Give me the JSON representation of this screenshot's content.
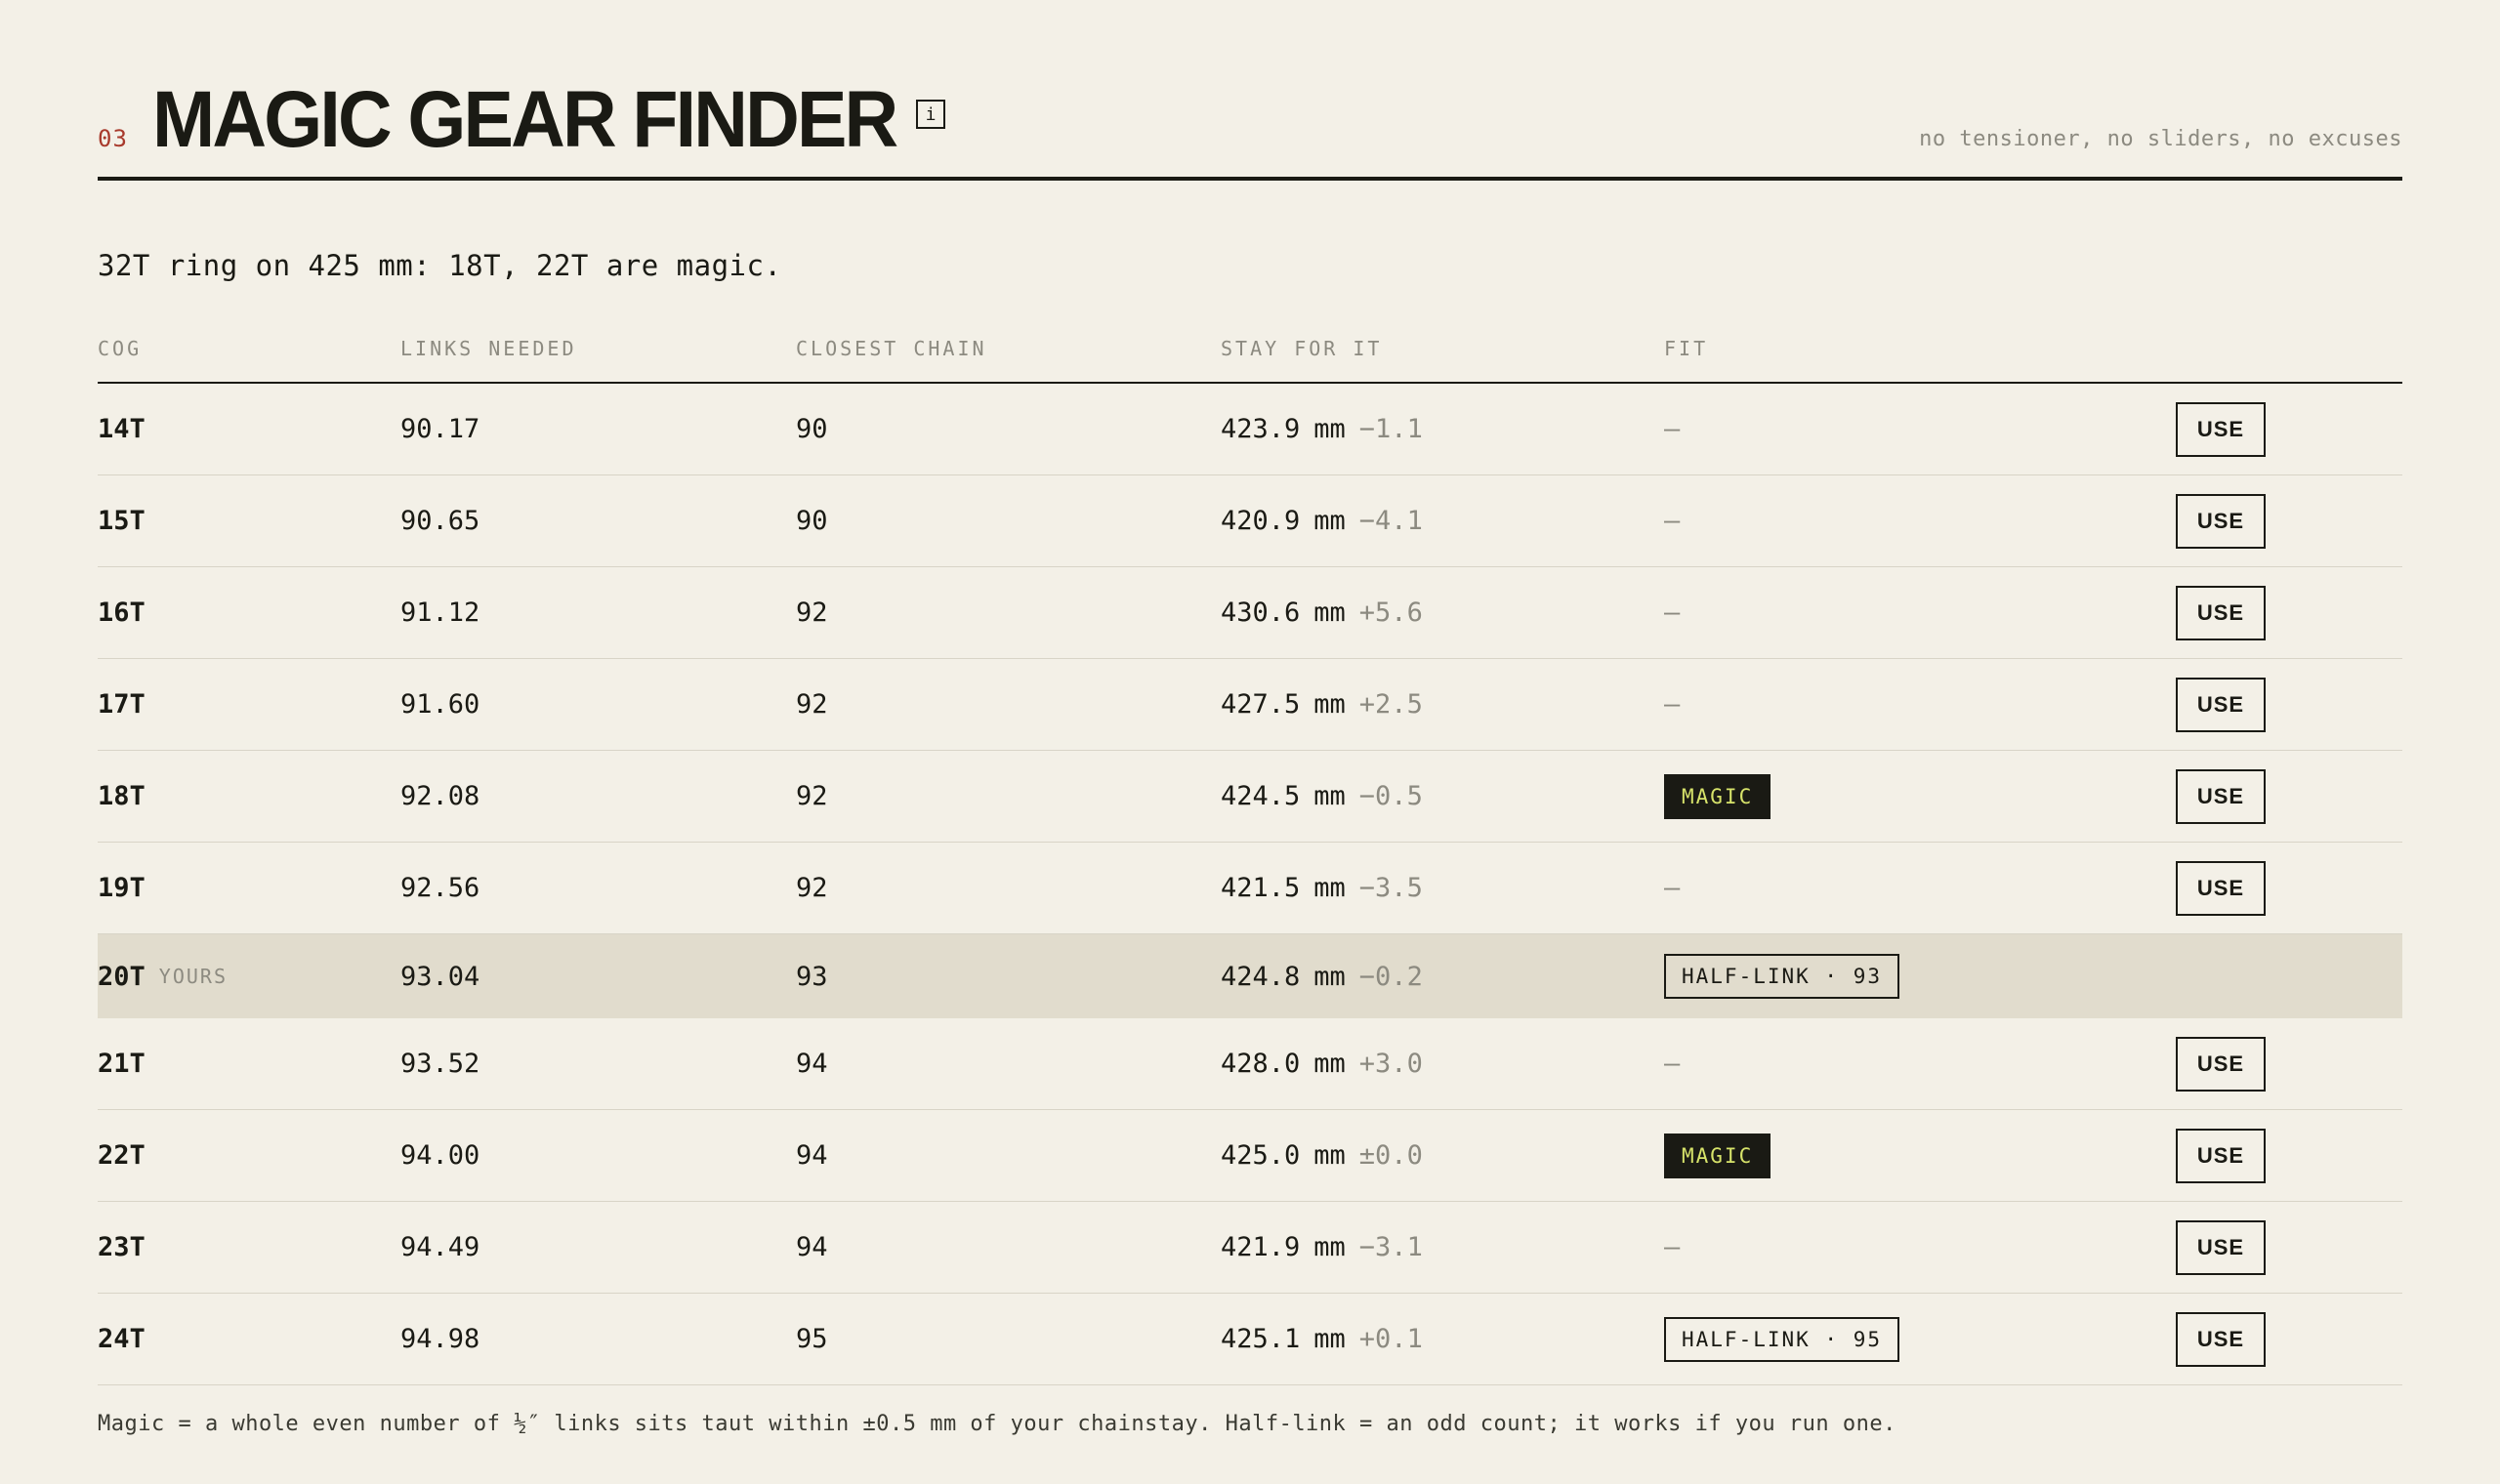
{
  "header": {
    "section_number": "03",
    "title": "MAGIC GEAR FINDER",
    "info_icon_glyph": "i",
    "tagline": "no tensioner, no sliders, no excuses"
  },
  "summary": "32T ring on 425 mm: 18T, 22T are magic.",
  "columns": {
    "cog": "COG",
    "links": "LINKS NEEDED",
    "chain": "CLOSEST CHAIN",
    "stay": "STAY FOR IT",
    "fit": "FIT"
  },
  "rows": [
    {
      "cog": "14T",
      "yours": "",
      "links": "90.17",
      "chain": "90",
      "stay": "423.9",
      "unit": "mm",
      "delta": "−1.1",
      "fit": "—",
      "fit_type": "none",
      "action": "USE"
    },
    {
      "cog": "15T",
      "yours": "",
      "links": "90.65",
      "chain": "90",
      "stay": "420.9",
      "unit": "mm",
      "delta": "−4.1",
      "fit": "—",
      "fit_type": "none",
      "action": "USE"
    },
    {
      "cog": "16T",
      "yours": "",
      "links": "91.12",
      "chain": "92",
      "stay": "430.6",
      "unit": "mm",
      "delta": "+5.6",
      "fit": "—",
      "fit_type": "none",
      "action": "USE"
    },
    {
      "cog": "17T",
      "yours": "",
      "links": "91.60",
      "chain": "92",
      "stay": "427.5",
      "unit": "mm",
      "delta": "+2.5",
      "fit": "—",
      "fit_type": "none",
      "action": "USE"
    },
    {
      "cog": "18T",
      "yours": "",
      "links": "92.08",
      "chain": "92",
      "stay": "424.5",
      "unit": "mm",
      "delta": "−0.5",
      "fit": "MAGIC",
      "fit_type": "magic",
      "action": "USE"
    },
    {
      "cog": "19T",
      "yours": "",
      "links": "92.56",
      "chain": "92",
      "stay": "421.5",
      "unit": "mm",
      "delta": "−3.5",
      "fit": "—",
      "fit_type": "none",
      "action": "USE"
    },
    {
      "cog": "20T",
      "yours": "YOURS",
      "links": "93.04",
      "chain": "93",
      "stay": "424.8",
      "unit": "mm",
      "delta": "−0.2",
      "fit": "HALF-LINK · 93",
      "fit_type": "half",
      "action": ""
    },
    {
      "cog": "21T",
      "yours": "",
      "links": "93.52",
      "chain": "94",
      "stay": "428.0",
      "unit": "mm",
      "delta": "+3.0",
      "fit": "—",
      "fit_type": "none",
      "action": "USE"
    },
    {
      "cog": "22T",
      "yours": "",
      "links": "94.00",
      "chain": "94",
      "stay": "425.0",
      "unit": "mm",
      "delta": "±0.0",
      "fit": "MAGIC",
      "fit_type": "magic",
      "action": "USE"
    },
    {
      "cog": "23T",
      "yours": "",
      "links": "94.49",
      "chain": "94",
      "stay": "421.9",
      "unit": "mm",
      "delta": "−3.1",
      "fit": "—",
      "fit_type": "none",
      "action": "USE"
    },
    {
      "cog": "24T",
      "yours": "",
      "links": "94.98",
      "chain": "95",
      "stay": "425.1",
      "unit": "mm",
      "delta": "+0.1",
      "fit": "HALF-LINK · 95",
      "fit_type": "half",
      "action": "USE"
    }
  ],
  "footnote": "Magic = a whole even number of ½″ links sits taut within ±0.5 mm of your chainstay. Half-link = an odd count; it works if you run one.",
  "colors": {
    "background": "#f3f0e7",
    "ink": "#1a1a14",
    "muted": "#8c8a80",
    "accent_red": "#a83a2c",
    "magic_text": "#d7e36a",
    "current_row": "#e1dccd"
  }
}
